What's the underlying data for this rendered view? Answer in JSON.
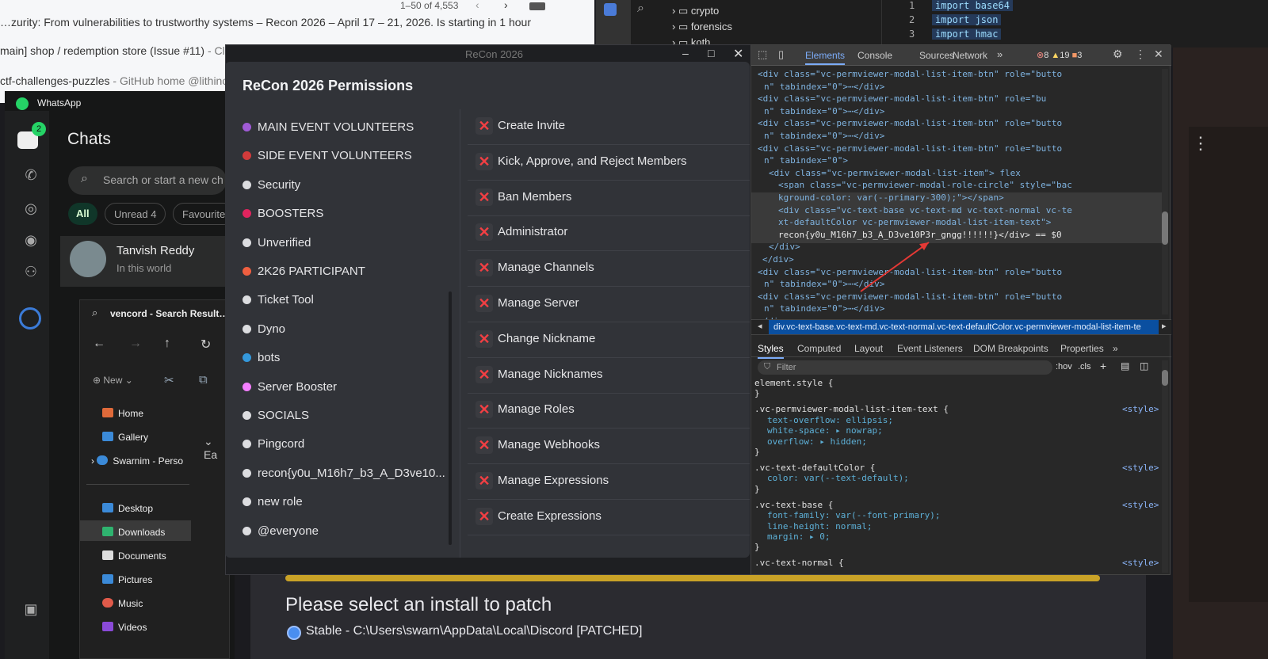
{
  "browser": {
    "pagination": "1–50 of 4,553",
    "lines": [
      {
        "main": "…zurity: From vulnerabilities to trustworthy systems – Recon 2026 – April 17 – 21, 2026. Is starting in 1 hour",
        "gray": ""
      },
      {
        "main": "main] shop / redemption store (Issue #11)",
        "gray": " - Close"
      },
      {
        "main": "ctf-challenges-puzzles",
        "gray": " - GitHub home @lithinc"
      }
    ]
  },
  "vscode": {
    "tree": [
      "crypto",
      "forensics",
      "koth"
    ],
    "line_numbers": [
      "1",
      "2",
      "3"
    ],
    "code": [
      "import base64",
      "import json",
      "import hmac"
    ]
  },
  "whatsapp": {
    "app_title": "WhatsApp",
    "chats_title": "Chats",
    "search_placeholder": "Search or start a new ch",
    "filters": [
      "All",
      "Unread 4",
      "Favourite"
    ],
    "chat_name": "Tanvish Reddy",
    "chat_preview": "In this world",
    "badge": "2"
  },
  "explorer": {
    "search_title": "vencord - Search Results in",
    "new_label": "New",
    "items": [
      "Home",
      "Gallery",
      "Swarnim - Perso",
      "Desktop",
      "Downloads",
      "Documents",
      "Pictures",
      "Music",
      "Videos"
    ],
    "partial": "Ea"
  },
  "discord": {
    "window_title": "ReCon 2026",
    "modal_title": "ReCon 2026 Permissions",
    "roles": [
      {
        "name": "MAIN EVENT VOLUNTEERS",
        "color": "#a05bd6"
      },
      {
        "name": "SIDE EVENT VOLUNTEERS",
        "color": "#d23b3b"
      },
      {
        "name": "Security",
        "color": "#dcdde0"
      },
      {
        "name": "BOOSTERS",
        "color": "#e0245e"
      },
      {
        "name": "Unverified",
        "color": "#dcdde0"
      },
      {
        "name": "2K26 PARTICIPANT",
        "color": "#ef5f40"
      },
      {
        "name": "Ticket Tool",
        "color": "#dcdde0"
      },
      {
        "name": "Dyno",
        "color": "#dcdde0"
      },
      {
        "name": "bots",
        "color": "#3498db"
      },
      {
        "name": "Server Booster",
        "color": "#f47fff"
      },
      {
        "name": "SOCIALS",
        "color": "#dcdde0"
      },
      {
        "name": "Pingcord",
        "color": "#dcdde0"
      },
      {
        "name": "recon{y0u_M16h7_b3_A_D3ve10...",
        "color": "#dcdde0"
      },
      {
        "name": "new role",
        "color": "#dcdde0"
      },
      {
        "name": "@everyone",
        "color": "#dcdde0"
      }
    ],
    "permissions": [
      "Create Invite",
      "Kick, Approve, and Reject Members",
      "Ban Members",
      "Administrator",
      "Manage Channels",
      "Manage Server",
      "Change Nickname",
      "Manage Nicknames",
      "Manage Roles",
      "Manage Webhooks",
      "Manage Expressions",
      "Create Expressions"
    ]
  },
  "devtools": {
    "tabs": [
      "Elements",
      "Console",
      "Sources",
      "Network"
    ],
    "errors": "8",
    "warnings": "19",
    "issues": "3",
    "dom_lines": [
      "<div class=\"vc-permviewer-modal-list-item-btn\" role=\"butto",
      "n\" tabindex=\"0\">⋯</div>",
      "<div class=\"vc-permviewer-modal-list-item-btn\" role=\"bu",
      "n\" tabindex=\"0\">⋯</div>",
      "<div class=\"vc-permviewer-modal-list-item-btn\" role=\"butto",
      "n\" tabindex=\"0\">⋯</div>",
      "<div class=\"vc-permviewer-modal-list-item-btn\" role=\"butto",
      "n\" tabindex=\"0\">",
      "<div class=\"vc-permviewer-modal-list-item\"> flex",
      "<span class=\"vc-permviewer-modal-role-circle\" style=\"bac",
      "kground-color: var(--primary-300);\"></span>",
      "<div class=\"vc-text-base vc-text-md vc-text-normal vc-te",
      "xt-defaultColor vc-permviewer-modal-list-item-text\">",
      "recon{y0u_M16h7_b3_A_D3ve10P3r_gngg!!!!!!}</div> == $0",
      "</div>",
      "</div>",
      "<div class=\"vc-permviewer-modal-list-item-btn\" role=\"butto",
      "n\" tabindex=\"0\">⋯</div>",
      "<div class=\"vc-permviewer-modal-list-item-btn\" role=\"butto",
      "n\" tabindex=\"0\">⋯</div>",
      "</div>"
    ],
    "breadcrumb": "div.vc-text-base.vc-text-md.vc-text-normal.vc-text-defaultColor.vc-permviewer-modal-list-item-te",
    "style_tabs": [
      "Styles",
      "Computed",
      "Layout",
      "Event Listeners",
      "DOM Breakpoints",
      "Properties"
    ],
    "filter_placeholder": "Filter",
    "hov": ":hov",
    "cls": ".cls",
    "css_lines": [
      {
        "t": "sel",
        "text": "element.style {"
      },
      {
        "t": "end",
        "text": "}"
      },
      {
        "t": "sel",
        "text": ".vc-permviewer-modal-list-item-text {",
        "src": "<style>"
      },
      {
        "t": "prop",
        "text": "text-overflow: ellipsis;"
      },
      {
        "t": "prop",
        "text": "white-space: ▸ nowrap;"
      },
      {
        "t": "prop",
        "text": "overflow: ▸ hidden;"
      },
      {
        "t": "end",
        "text": "}"
      },
      {
        "t": "sel",
        "text": ".vc-text-defaultColor {",
        "src": "<style>"
      },
      {
        "t": "prop",
        "text": "color: var(--text-default);"
      },
      {
        "t": "end",
        "text": "}"
      },
      {
        "t": "sel",
        "text": ".vc-text-base {",
        "src": "<style>"
      },
      {
        "t": "prop",
        "text": "font-family: var(--font-primary);"
      },
      {
        "t": "prop",
        "text": "line-height: normal;"
      },
      {
        "t": "prop",
        "text": "margin: ▸ 0;"
      },
      {
        "t": "end",
        "text": "}"
      },
      {
        "t": "sel",
        "text": ".vc-text-normal {",
        "src": "<style>"
      }
    ]
  },
  "installer": {
    "heading": "Please select an install to patch",
    "option": "Stable - C:\\Users\\swarn\\AppData\\Local\\Discord [PATCHED]"
  }
}
